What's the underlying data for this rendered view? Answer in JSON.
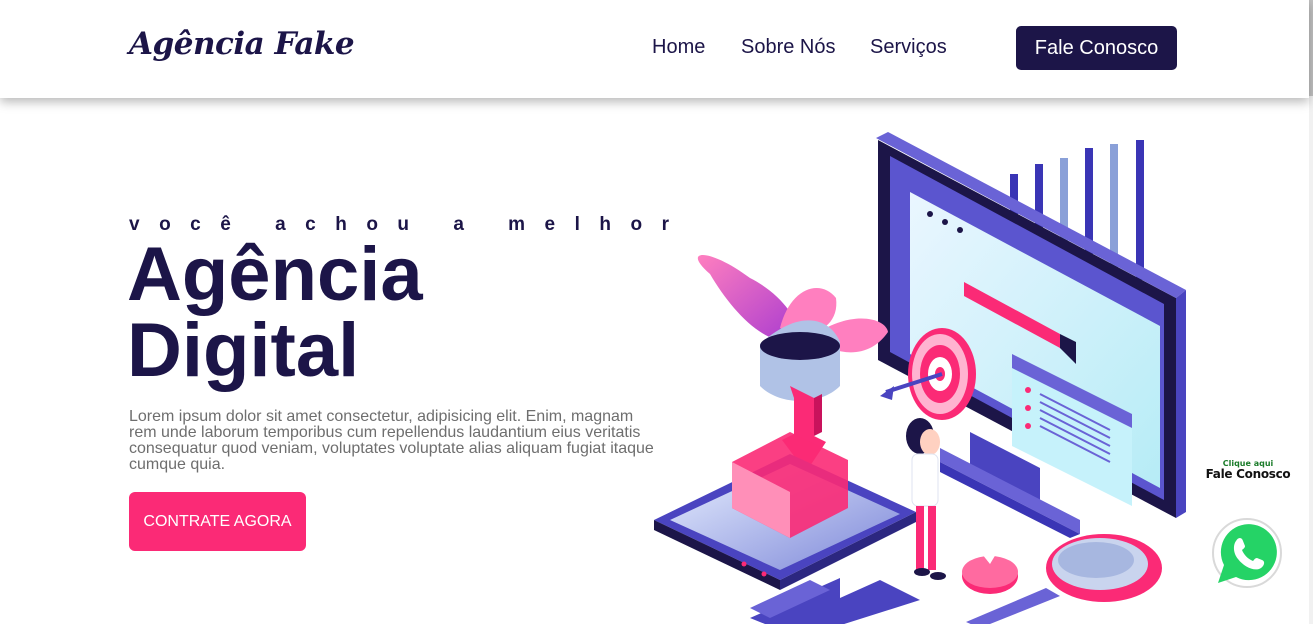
{
  "header": {
    "logo": "Agência Fake",
    "nav": [
      "Home",
      "Sobre Nós",
      "Serviços"
    ],
    "cta": "Fale Conosco"
  },
  "hero": {
    "tagline": "você achou a melhor",
    "title_line1": "Agência",
    "title_line2": "Digital",
    "description": "Lorem ipsum dolor sit amet consectetur, adipisicing elit. Enim, magnam rem unde laborum temporibus cum repellendus laudantium eius veritatis consequatur quod veniam, voluptates voluptate alias aliquam fugiat itaque cumque quia.",
    "button": "CONTRATE AGORA"
  },
  "whatsapp": {
    "small_text": "Clique aqui",
    "big_text": "Fale Conosco"
  },
  "colors": {
    "primary": "#1c1548",
    "accent": "#fb2a76",
    "whatsapp": "#25d366"
  },
  "icons": {
    "illustration": "digital-marketing-illustration",
    "chat": "whatsapp-icon"
  }
}
